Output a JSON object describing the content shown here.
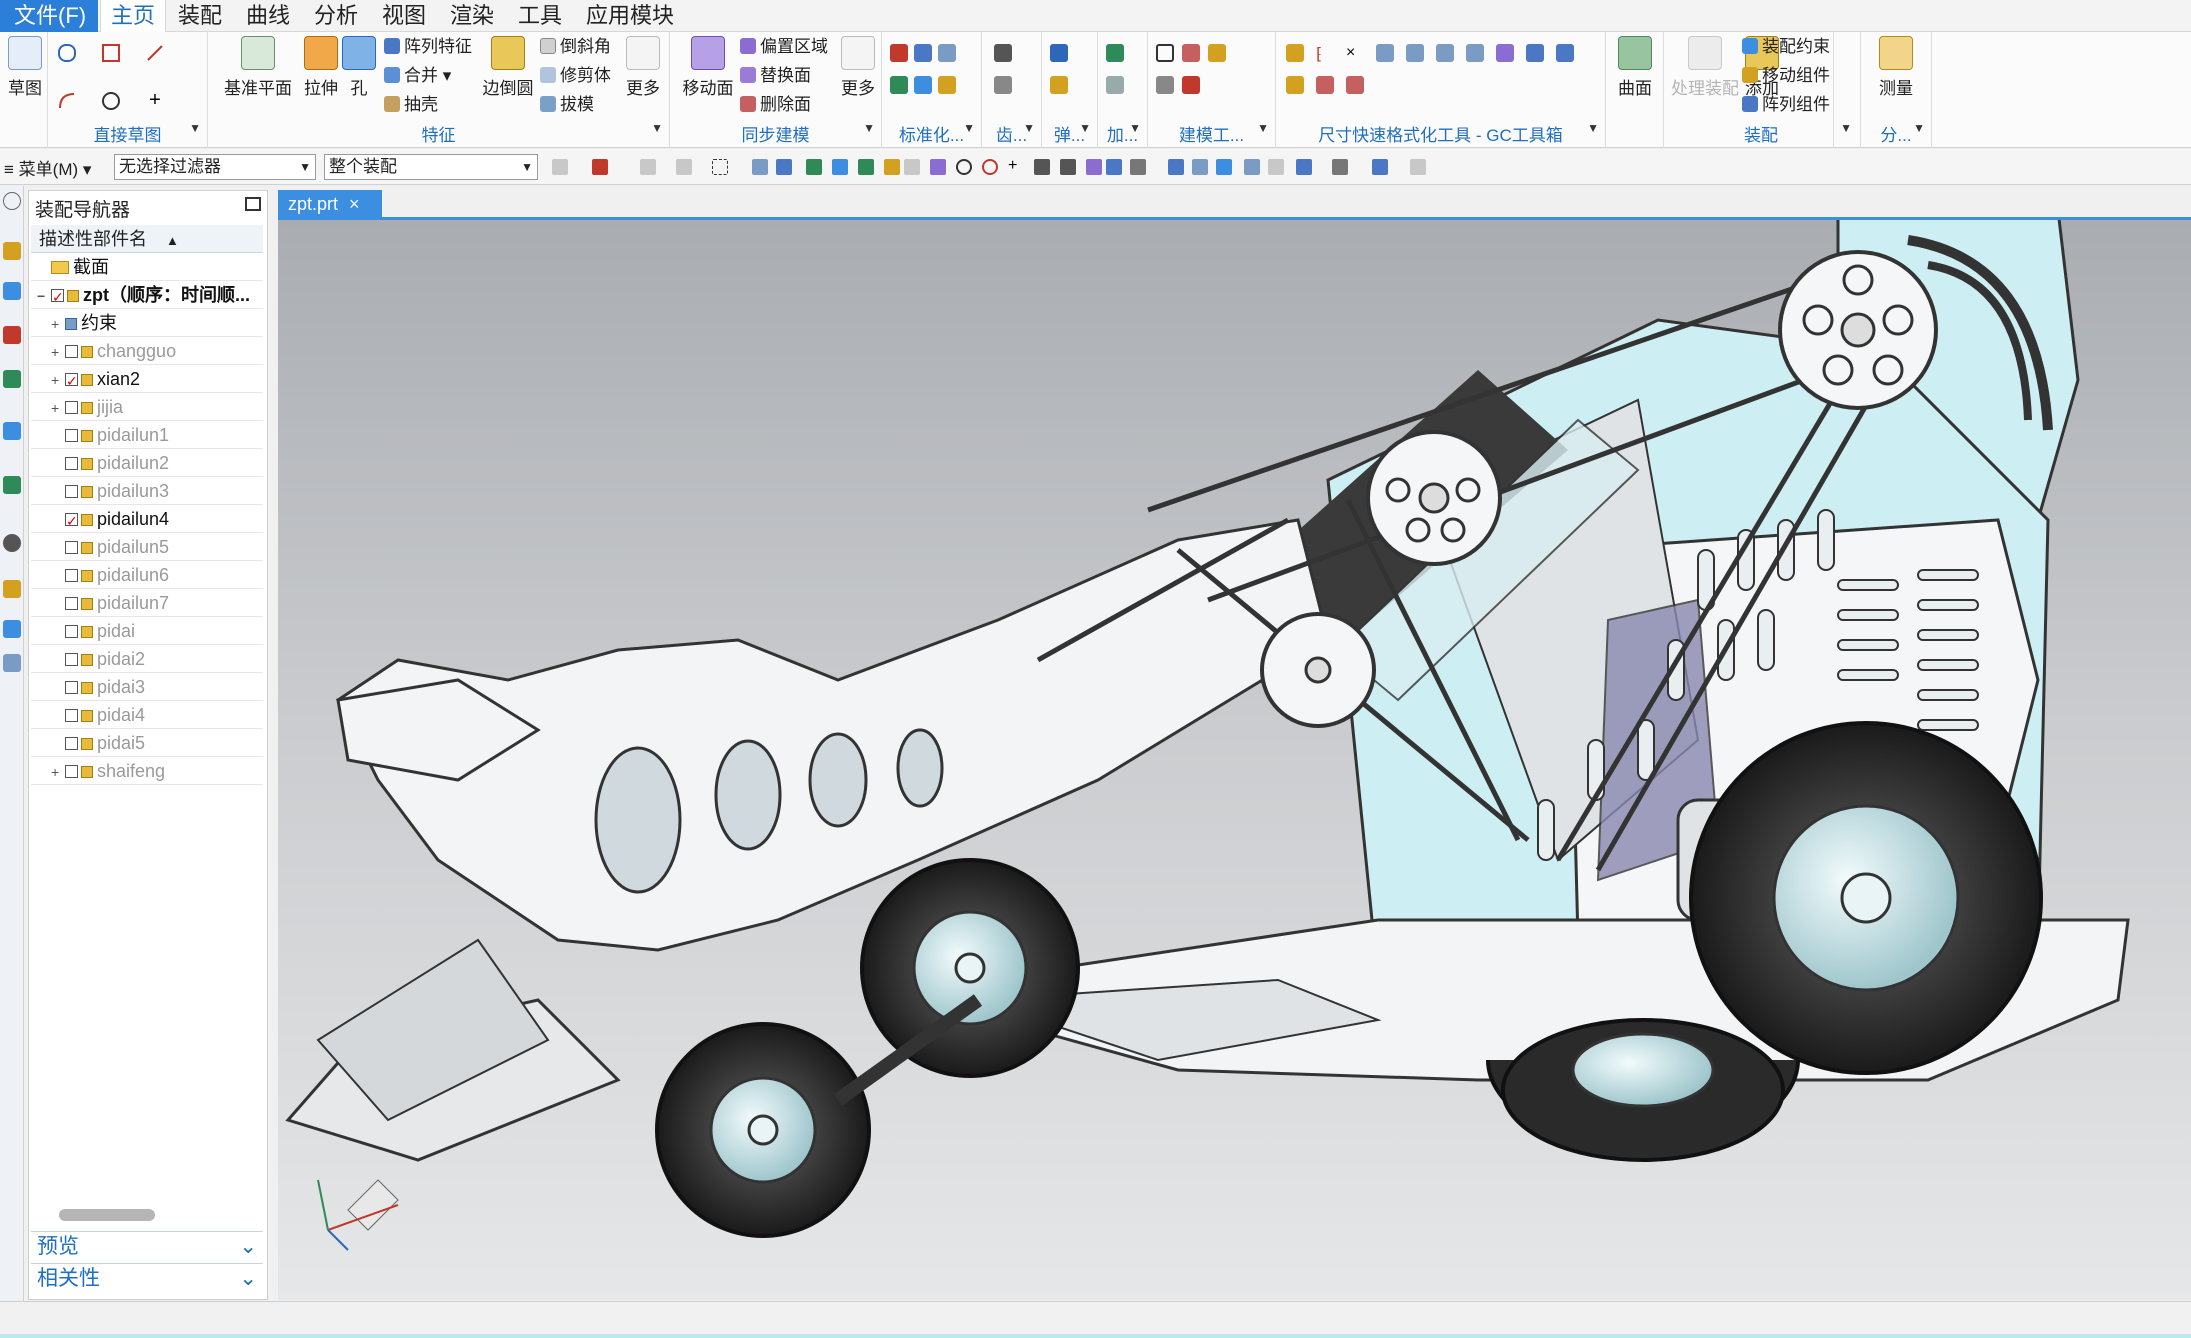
{
  "menubar": {
    "file": "文件(F)",
    "tabs": [
      "主页",
      "装配",
      "曲线",
      "分析",
      "视图",
      "渲染",
      "工具",
      "应用模块"
    ],
    "active_tab": "主页"
  },
  "ribbon": {
    "sketch": {
      "label": "草图",
      "group": "直接草图"
    },
    "feature": {
      "datum_plane": "基准平面",
      "extrude": "拉伸",
      "hole": "孔",
      "pattern": "阵列特征",
      "unite": "合并",
      "shell": "抽壳",
      "edge_blend": "边倒圆",
      "chamfer": "倒斜角",
      "trim_body": "修剪体",
      "draft": "拔模",
      "more": "更多",
      "group": "特征"
    },
    "sync": {
      "move_face": "移动面",
      "offset_region": "偏置区域",
      "replace_face": "替换面",
      "delete_face": "删除面",
      "more": "更多",
      "group": "同步建模"
    },
    "small_groups": [
      "标准化...",
      "齿...",
      "弹...",
      "加...",
      "建模工...",
      "尺寸快速格式化工具 - GC工具箱"
    ],
    "surface": {
      "label": "曲面"
    },
    "assembly": {
      "process": "处理装配",
      "add": "添加",
      "constraint": "装配约束",
      "move_component": "移动组件",
      "pattern_component": "阵列组件",
      "group": "装配"
    },
    "measure": {
      "label": "测量",
      "group": "分..."
    }
  },
  "toolbar2": {
    "menu": "菜单(M)",
    "filter": "无选择过滤器",
    "scope": "整个装配"
  },
  "navigator": {
    "title": "装配导航器",
    "column": "描述性部件名",
    "rows": [
      {
        "label": "截面",
        "type": "folder",
        "checked": false,
        "expand": "",
        "style": "black"
      },
      {
        "label": "zpt（顺序：时间顺...",
        "type": "assy",
        "checked": true,
        "expand": "−",
        "style": "black bold"
      },
      {
        "label": "约束",
        "type": "constraint",
        "checked": false,
        "expand": "+",
        "style": "black"
      },
      {
        "label": "changguo",
        "type": "assy",
        "checked": false,
        "expand": "+",
        "style": "gray"
      },
      {
        "label": "xian2",
        "type": "assy",
        "checked": true,
        "expand": "+",
        "style": "black"
      },
      {
        "label": "jijia",
        "type": "assy",
        "checked": false,
        "expand": "+",
        "style": "gray"
      },
      {
        "label": "pidailun1",
        "type": "part",
        "checked": false,
        "expand": "",
        "style": "gray"
      },
      {
        "label": "pidailun2",
        "type": "part",
        "checked": false,
        "expand": "",
        "style": "gray"
      },
      {
        "label": "pidailun3",
        "type": "part",
        "checked": false,
        "expand": "",
        "style": "gray"
      },
      {
        "label": "pidailun4",
        "type": "part",
        "checked": true,
        "expand": "",
        "style": "black"
      },
      {
        "label": "pidailun5",
        "type": "part",
        "checked": false,
        "expand": "",
        "style": "gray"
      },
      {
        "label": "pidailun6",
        "type": "part",
        "checked": false,
        "expand": "",
        "style": "gray"
      },
      {
        "label": "pidailun7",
        "type": "part",
        "checked": false,
        "expand": "",
        "style": "gray"
      },
      {
        "label": "pidai",
        "type": "part",
        "checked": false,
        "expand": "",
        "style": "gray"
      },
      {
        "label": "pidai2",
        "type": "part",
        "checked": false,
        "expand": "",
        "style": "gray"
      },
      {
        "label": "pidai3",
        "type": "part",
        "checked": false,
        "expand": "",
        "style": "gray"
      },
      {
        "label": "pidai4",
        "type": "part",
        "checked": false,
        "expand": "",
        "style": "gray"
      },
      {
        "label": "pidai5",
        "type": "part",
        "checked": false,
        "expand": "",
        "style": "gray"
      },
      {
        "label": "shaifeng",
        "type": "assy",
        "checked": false,
        "expand": "+",
        "style": "gray"
      }
    ],
    "preview": "预览",
    "dependencies": "相关性"
  },
  "document_tab": "zpt.prt",
  "colors": {
    "accent": "#3b8ee0",
    "viewport_top": "#a9acb1",
    "viewport_bottom": "#e6e7e8",
    "panel_light_blue": "#cdeef2"
  }
}
